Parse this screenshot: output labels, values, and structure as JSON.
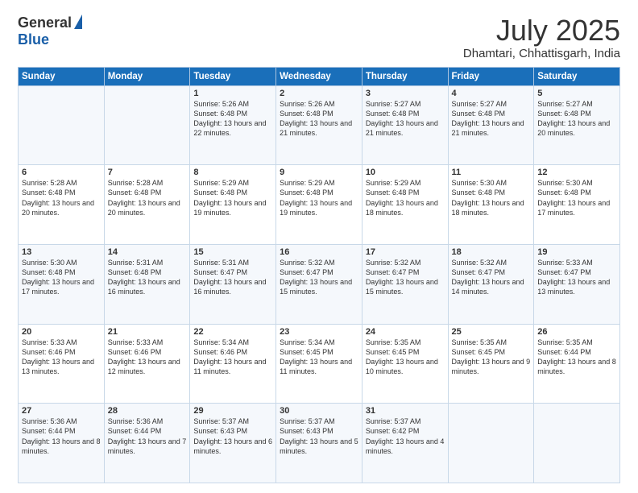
{
  "logo": {
    "general": "General",
    "blue": "Blue"
  },
  "header": {
    "month": "July 2025",
    "location": "Dhamtari, Chhattisgarh, India"
  },
  "weekdays": [
    "Sunday",
    "Monday",
    "Tuesday",
    "Wednesday",
    "Thursday",
    "Friday",
    "Saturday"
  ],
  "weeks": [
    [
      {
        "day": "",
        "sunrise": "",
        "sunset": "",
        "daylight": ""
      },
      {
        "day": "",
        "sunrise": "",
        "sunset": "",
        "daylight": ""
      },
      {
        "day": "1",
        "sunrise": "Sunrise: 5:26 AM",
        "sunset": "Sunset: 6:48 PM",
        "daylight": "Daylight: 13 hours and 22 minutes."
      },
      {
        "day": "2",
        "sunrise": "Sunrise: 5:26 AM",
        "sunset": "Sunset: 6:48 PM",
        "daylight": "Daylight: 13 hours and 21 minutes."
      },
      {
        "day": "3",
        "sunrise": "Sunrise: 5:27 AM",
        "sunset": "Sunset: 6:48 PM",
        "daylight": "Daylight: 13 hours and 21 minutes."
      },
      {
        "day": "4",
        "sunrise": "Sunrise: 5:27 AM",
        "sunset": "Sunset: 6:48 PM",
        "daylight": "Daylight: 13 hours and 21 minutes."
      },
      {
        "day": "5",
        "sunrise": "Sunrise: 5:27 AM",
        "sunset": "Sunset: 6:48 PM",
        "daylight": "Daylight: 13 hours and 20 minutes."
      }
    ],
    [
      {
        "day": "6",
        "sunrise": "Sunrise: 5:28 AM",
        "sunset": "Sunset: 6:48 PM",
        "daylight": "Daylight: 13 hours and 20 minutes."
      },
      {
        "day": "7",
        "sunrise": "Sunrise: 5:28 AM",
        "sunset": "Sunset: 6:48 PM",
        "daylight": "Daylight: 13 hours and 20 minutes."
      },
      {
        "day": "8",
        "sunrise": "Sunrise: 5:29 AM",
        "sunset": "Sunset: 6:48 PM",
        "daylight": "Daylight: 13 hours and 19 minutes."
      },
      {
        "day": "9",
        "sunrise": "Sunrise: 5:29 AM",
        "sunset": "Sunset: 6:48 PM",
        "daylight": "Daylight: 13 hours and 19 minutes."
      },
      {
        "day": "10",
        "sunrise": "Sunrise: 5:29 AM",
        "sunset": "Sunset: 6:48 PM",
        "daylight": "Daylight: 13 hours and 18 minutes."
      },
      {
        "day": "11",
        "sunrise": "Sunrise: 5:30 AM",
        "sunset": "Sunset: 6:48 PM",
        "daylight": "Daylight: 13 hours and 18 minutes."
      },
      {
        "day": "12",
        "sunrise": "Sunrise: 5:30 AM",
        "sunset": "Sunset: 6:48 PM",
        "daylight": "Daylight: 13 hours and 17 minutes."
      }
    ],
    [
      {
        "day": "13",
        "sunrise": "Sunrise: 5:30 AM",
        "sunset": "Sunset: 6:48 PM",
        "daylight": "Daylight: 13 hours and 17 minutes."
      },
      {
        "day": "14",
        "sunrise": "Sunrise: 5:31 AM",
        "sunset": "Sunset: 6:48 PM",
        "daylight": "Daylight: 13 hours and 16 minutes."
      },
      {
        "day": "15",
        "sunrise": "Sunrise: 5:31 AM",
        "sunset": "Sunset: 6:47 PM",
        "daylight": "Daylight: 13 hours and 16 minutes."
      },
      {
        "day": "16",
        "sunrise": "Sunrise: 5:32 AM",
        "sunset": "Sunset: 6:47 PM",
        "daylight": "Daylight: 13 hours and 15 minutes."
      },
      {
        "day": "17",
        "sunrise": "Sunrise: 5:32 AM",
        "sunset": "Sunset: 6:47 PM",
        "daylight": "Daylight: 13 hours and 15 minutes."
      },
      {
        "day": "18",
        "sunrise": "Sunrise: 5:32 AM",
        "sunset": "Sunset: 6:47 PM",
        "daylight": "Daylight: 13 hours and 14 minutes."
      },
      {
        "day": "19",
        "sunrise": "Sunrise: 5:33 AM",
        "sunset": "Sunset: 6:47 PM",
        "daylight": "Daylight: 13 hours and 13 minutes."
      }
    ],
    [
      {
        "day": "20",
        "sunrise": "Sunrise: 5:33 AM",
        "sunset": "Sunset: 6:46 PM",
        "daylight": "Daylight: 13 hours and 13 minutes."
      },
      {
        "day": "21",
        "sunrise": "Sunrise: 5:33 AM",
        "sunset": "Sunset: 6:46 PM",
        "daylight": "Daylight: 13 hours and 12 minutes."
      },
      {
        "day": "22",
        "sunrise": "Sunrise: 5:34 AM",
        "sunset": "Sunset: 6:46 PM",
        "daylight": "Daylight: 13 hours and 11 minutes."
      },
      {
        "day": "23",
        "sunrise": "Sunrise: 5:34 AM",
        "sunset": "Sunset: 6:45 PM",
        "daylight": "Daylight: 13 hours and 11 minutes."
      },
      {
        "day": "24",
        "sunrise": "Sunrise: 5:35 AM",
        "sunset": "Sunset: 6:45 PM",
        "daylight": "Daylight: 13 hours and 10 minutes."
      },
      {
        "day": "25",
        "sunrise": "Sunrise: 5:35 AM",
        "sunset": "Sunset: 6:45 PM",
        "daylight": "Daylight: 13 hours and 9 minutes."
      },
      {
        "day": "26",
        "sunrise": "Sunrise: 5:35 AM",
        "sunset": "Sunset: 6:44 PM",
        "daylight": "Daylight: 13 hours and 8 minutes."
      }
    ],
    [
      {
        "day": "27",
        "sunrise": "Sunrise: 5:36 AM",
        "sunset": "Sunset: 6:44 PM",
        "daylight": "Daylight: 13 hours and 8 minutes."
      },
      {
        "day": "28",
        "sunrise": "Sunrise: 5:36 AM",
        "sunset": "Sunset: 6:44 PM",
        "daylight": "Daylight: 13 hours and 7 minutes."
      },
      {
        "day": "29",
        "sunrise": "Sunrise: 5:37 AM",
        "sunset": "Sunset: 6:43 PM",
        "daylight": "Daylight: 13 hours and 6 minutes."
      },
      {
        "day": "30",
        "sunrise": "Sunrise: 5:37 AM",
        "sunset": "Sunset: 6:43 PM",
        "daylight": "Daylight: 13 hours and 5 minutes."
      },
      {
        "day": "31",
        "sunrise": "Sunrise: 5:37 AM",
        "sunset": "Sunset: 6:42 PM",
        "daylight": "Daylight: 13 hours and 4 minutes."
      },
      {
        "day": "",
        "sunrise": "",
        "sunset": "",
        "daylight": ""
      },
      {
        "day": "",
        "sunrise": "",
        "sunset": "",
        "daylight": ""
      }
    ]
  ]
}
